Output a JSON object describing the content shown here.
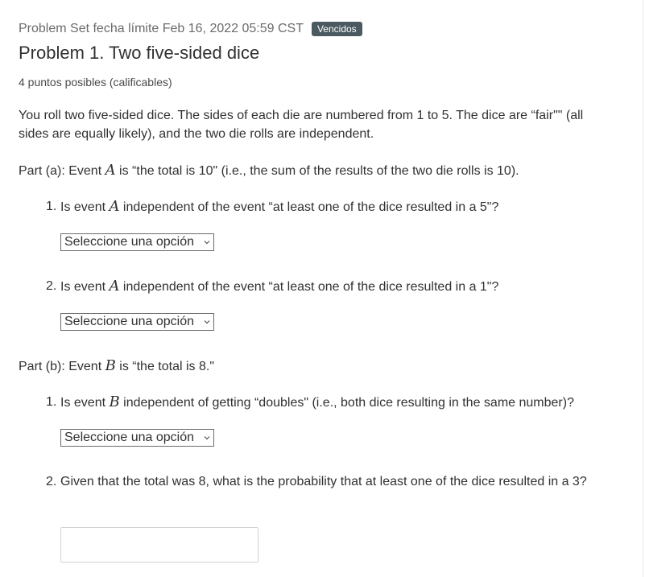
{
  "subsection": {
    "label": "Problem Set fecha límite Feb 16, 2022 05:59 CST",
    "badge": "Vencidos"
  },
  "problem": {
    "title": "Problem 1. Two five-sided dice",
    "points": "4 puntos posibles (calificables)",
    "intro": "You roll two five-sided dice. The sides of each die are numbered from 1 to 5. The dice are “fair\"\" (all sides are equally likely), and the two die rolls are independent.",
    "part_a": {
      "prefix": "Part (a): Event ",
      "var": "A",
      "suffix": " is “the total is 10\" (i.e., the sum of the results of the two die rolls is 10).",
      "questions": [
        {
          "num": "1.",
          "prefix": "Is event ",
          "var": "A",
          "suffix": " independent of the event “at least one of the dice resulted in a 5\"?",
          "select": "Seleccione una opción"
        },
        {
          "num": "2.",
          "prefix": "Is event ",
          "var": "A",
          "suffix": " independent of the event “at least one of the dice resulted in a 1\"?",
          "select": "Seleccione una opción"
        }
      ]
    },
    "part_b": {
      "prefix": "Part (b): Event ",
      "var": "B",
      "suffix": " is “the total is 8.\"",
      "questions": [
        {
          "num": "1.",
          "prefix": "Is event ",
          "var": "B",
          "suffix": " independent of getting “doubles\" (i.e., both dice resulting in the same number)?",
          "select": "Seleccione una opción"
        },
        {
          "num": "2.",
          "text": "Given that the total was 8, what is the probability that at least one of the dice resulted in a 3?",
          "input_value": ""
        }
      ]
    }
  }
}
